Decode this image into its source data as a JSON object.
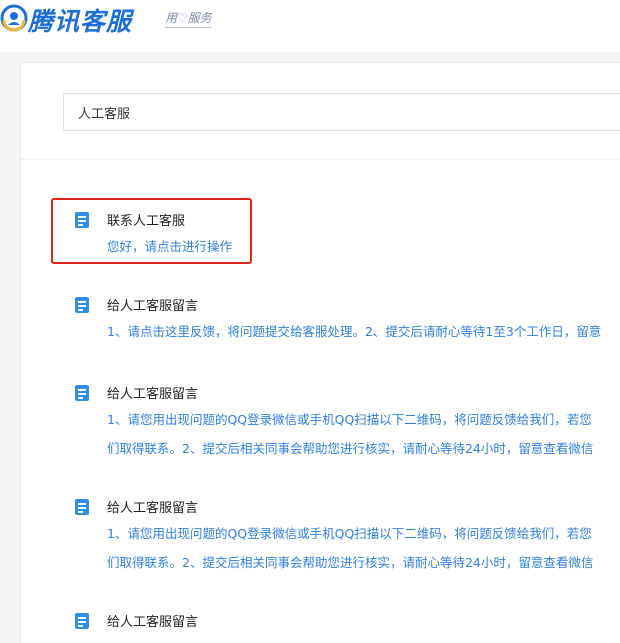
{
  "header": {
    "logo_text": "腾讯客服",
    "slogan": "用♡服务",
    "logo_icon": "tencent-logo-icon",
    "brand_color": "#1d6fd8"
  },
  "search": {
    "value": "人工客服"
  },
  "results": [
    {
      "title": "联系人工客服",
      "lines": [
        "您好，请点击进行操作"
      ],
      "highlighted": true
    },
    {
      "title": "给人工客服留言",
      "lines": [
        "1、请点击这里反馈，将问题提交给客服处理。2、提交后请耐心等待1至3个工作日，留意"
      ]
    },
    {
      "title": "给人工客服留言",
      "lines": [
        "1、请您用出现问题的QQ登录微信或手机QQ扫描以下二维码，将问题反馈给我们，若您",
        "们取得联系。2、提交后相关同事会帮助您进行核实，请耐心等待24小时，留意查看微信"
      ]
    },
    {
      "title": "给人工客服留言",
      "lines": [
        "1、请您用出现问题的QQ登录微信或手机QQ扫描以下二维码，将问题反馈给我们，若您",
        "们取得联系。2、提交后相关同事会帮助您进行核实，请耐心等待24小时，留意查看微信"
      ]
    },
    {
      "title": "给人工客服留言",
      "lines": []
    }
  ],
  "colors": {
    "link": "#2f7fe0",
    "highlight_border": "#e0251d",
    "doc_icon": "#2f8fe6"
  }
}
